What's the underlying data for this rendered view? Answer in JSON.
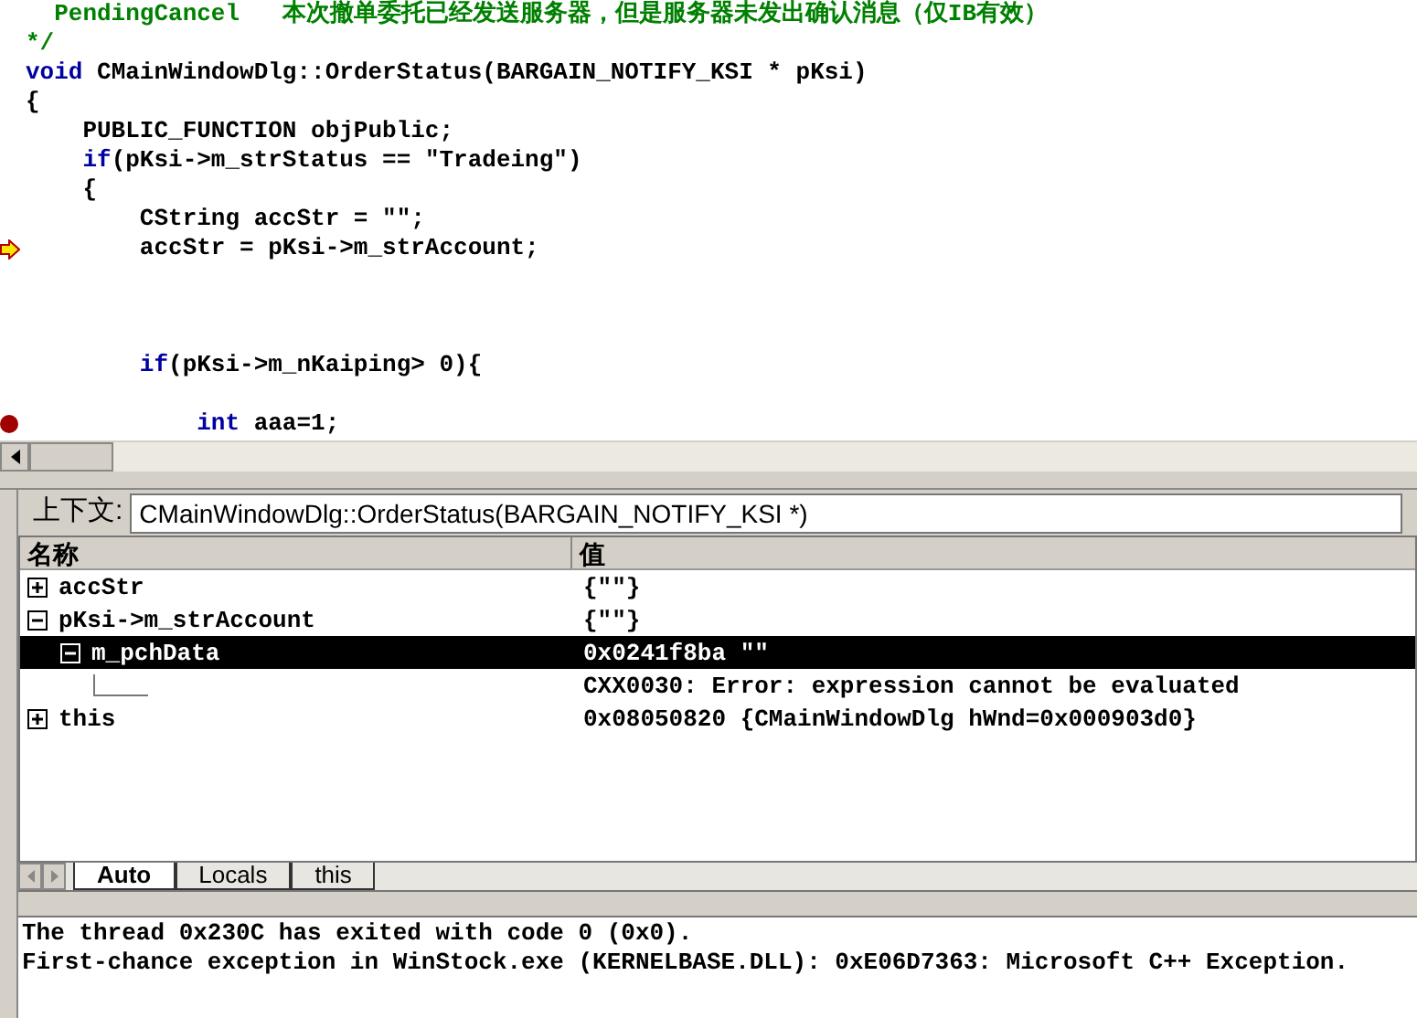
{
  "editor": {
    "lines": [
      {
        "kind": "code",
        "execution_point": false,
        "breakpoint": false,
        "tokens": [
          {
            "text": "  PendingCancel   本次撤单委托已经发送服务器，但是服务器未发出确认消息（仅IB有效）",
            "kind": "comment"
          }
        ]
      },
      {
        "kind": "code",
        "execution_point": false,
        "breakpoint": false,
        "tokens": [
          {
            "text": "*/",
            "kind": "comment"
          }
        ]
      },
      {
        "kind": "code",
        "execution_point": false,
        "breakpoint": false,
        "tokens": [
          {
            "text": "void",
            "kind": "keyword"
          },
          {
            "text": " CMainWindowDlg::OrderStatus(BARGAIN_NOTIFY_KSI * pKsi)",
            "kind": "plain"
          }
        ]
      },
      {
        "kind": "code",
        "execution_point": false,
        "breakpoint": false,
        "tokens": [
          {
            "text": "{",
            "kind": "plain"
          }
        ]
      },
      {
        "kind": "code",
        "execution_point": false,
        "breakpoint": false,
        "tokens": [
          {
            "text": "    PUBLIC_FUNCTION objPublic;",
            "kind": "plain"
          }
        ]
      },
      {
        "kind": "code",
        "execution_point": false,
        "breakpoint": false,
        "tokens": [
          {
            "text": "    if",
            "kind": "keyword"
          },
          {
            "text": "(pKsi->m_strStatus == \"Tradeing\")",
            "kind": "plain"
          }
        ]
      },
      {
        "kind": "code",
        "execution_point": false,
        "breakpoint": false,
        "tokens": [
          {
            "text": "    {",
            "kind": "plain"
          }
        ]
      },
      {
        "kind": "code",
        "execution_point": false,
        "breakpoint": false,
        "tokens": [
          {
            "text": "        CString accStr = \"\";",
            "kind": "plain"
          }
        ]
      },
      {
        "kind": "code",
        "execution_point": true,
        "breakpoint": false,
        "tokens": [
          {
            "text": "        accStr = pKsi->m_strAccount;",
            "kind": "plain"
          }
        ]
      },
      {
        "kind": "blank",
        "execution_point": false,
        "breakpoint": false
      },
      {
        "kind": "blank",
        "execution_point": false,
        "breakpoint": false
      },
      {
        "kind": "blank",
        "execution_point": false,
        "breakpoint": false
      },
      {
        "kind": "code",
        "execution_point": false,
        "breakpoint": false,
        "tokens": [
          {
            "text": "        if",
            "kind": "keyword"
          },
          {
            "text": "(pKsi->m_nKaiping> 0){",
            "kind": "plain"
          }
        ]
      },
      {
        "kind": "blank",
        "execution_point": false,
        "breakpoint": false
      },
      {
        "kind": "code",
        "execution_point": false,
        "breakpoint": true,
        "tokens": [
          {
            "text": "            int",
            "kind": "keyword"
          },
          {
            "text": " aaa=1;",
            "kind": "plain"
          }
        ]
      }
    ]
  },
  "context": {
    "label": "上下文:",
    "value": "CMainWindowDlg::OrderStatus(BARGAIN_NOTIFY_KSI *)"
  },
  "watch": {
    "columns": [
      "名称",
      "值"
    ],
    "rows": [
      {
        "name": "accStr",
        "value": "{\"\"}",
        "expanded": false,
        "selected": false
      },
      {
        "name": "pKsi->m_strAccount",
        "value": "{\"\"}",
        "expanded": true,
        "selected": false,
        "children": [
          {
            "name": "m_pchData",
            "value": "0x0241f8ba \"\"",
            "expanded": true,
            "selected": true,
            "children": [
              {
                "value": "CXX0030: Error: expression cannot be evaluated",
                "selected": false
              }
            ]
          }
        ]
      },
      {
        "name": "this",
        "value": "0x08050820 {CMainWindowDlg hWnd=0x000903d0}",
        "expanded": false,
        "selected": false
      }
    ],
    "tabs": [
      {
        "label": "Auto",
        "selected": true
      },
      {
        "label": "Locals",
        "selected": false
      },
      {
        "label": "this",
        "selected": false
      }
    ]
  },
  "output": {
    "lines": [
      "The thread 0x230C has exited with code 0 (0x0).",
      "First-chance exception in WinStock.exe (KERNELBASE.DLL): 0xE06D7363: Microsoft C++ Exception."
    ]
  }
}
